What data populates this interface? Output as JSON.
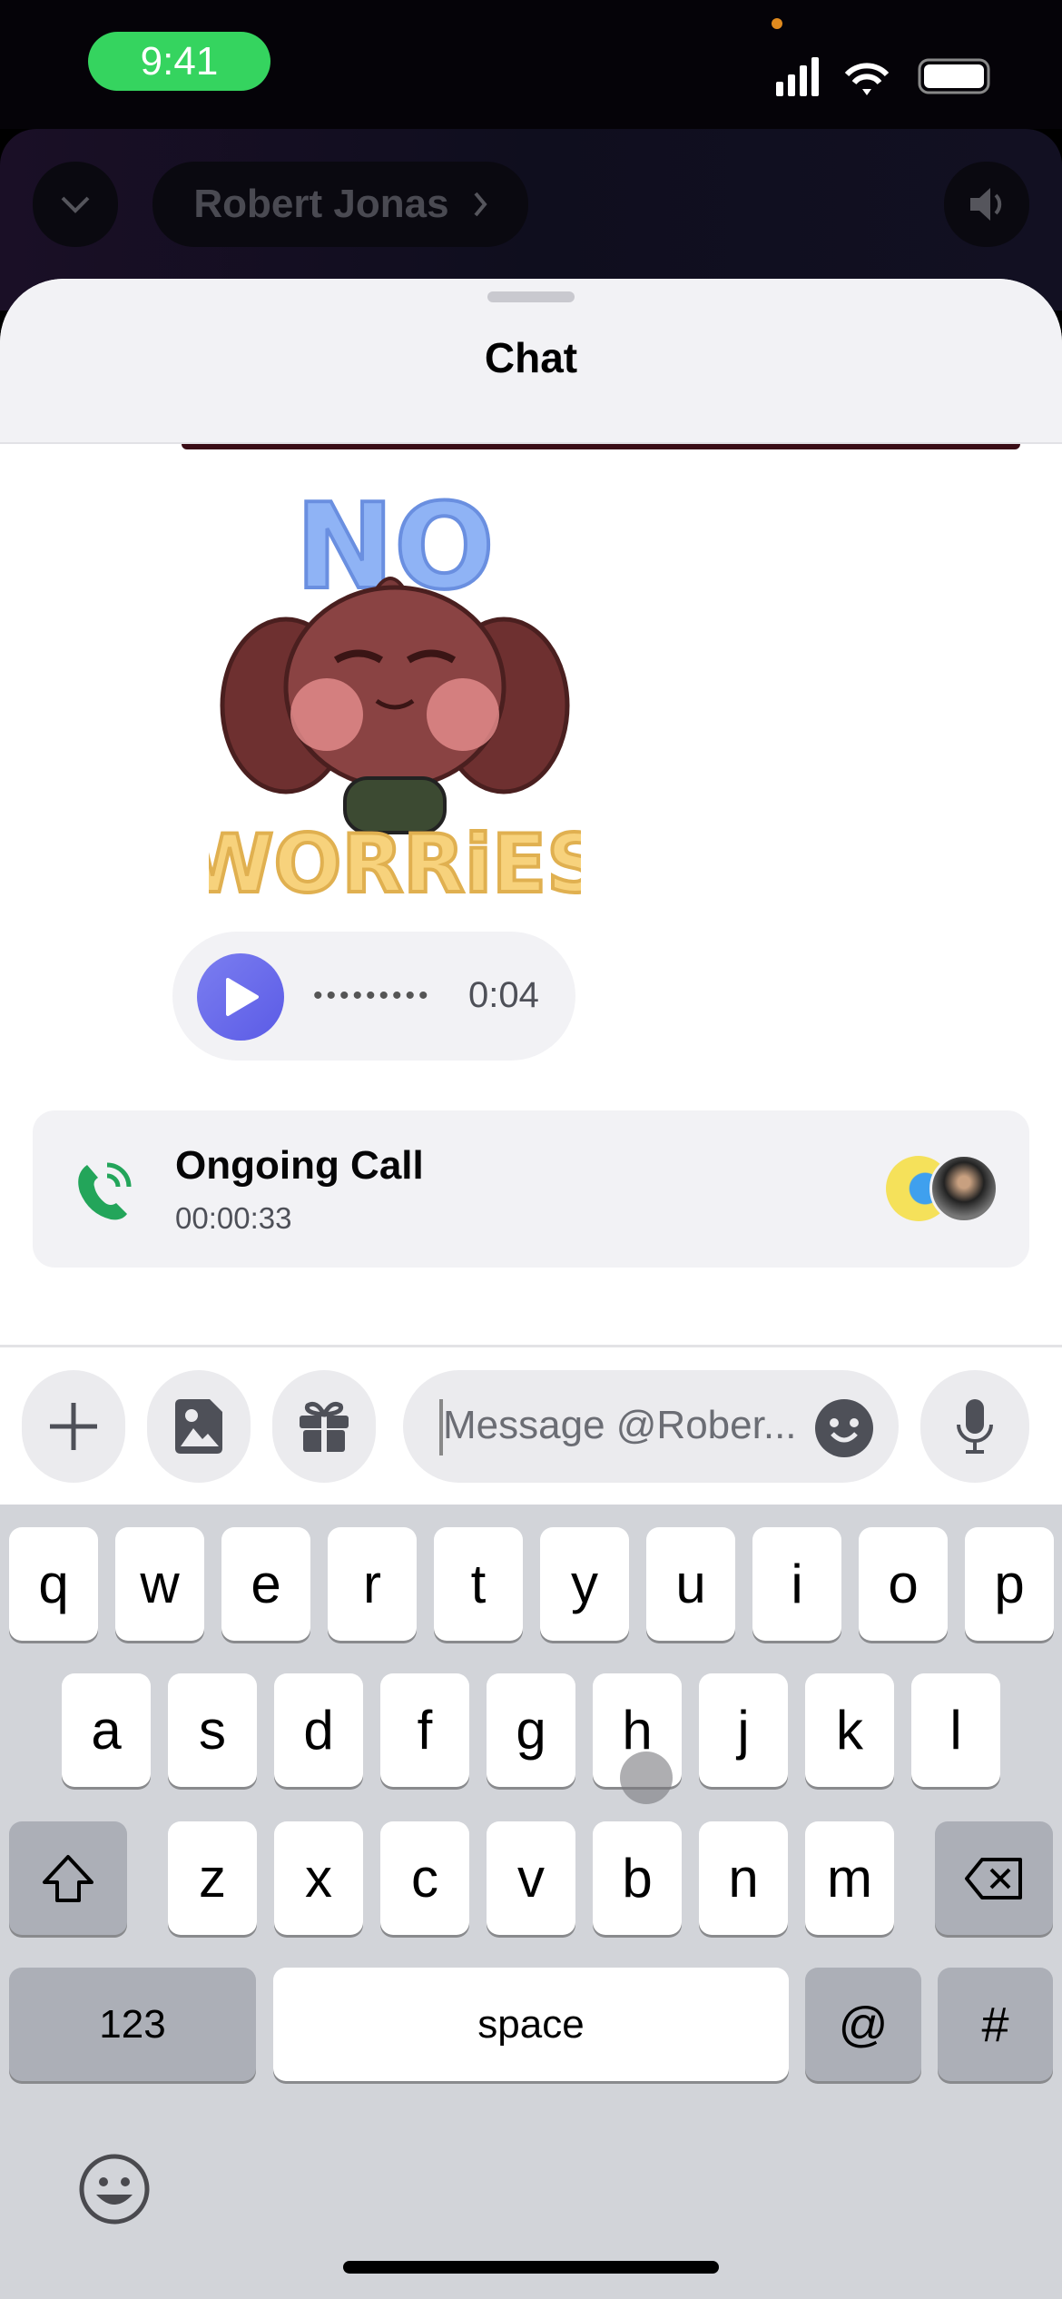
{
  "status_bar": {
    "time": "9:41",
    "icons": [
      "cellular-signal-icon",
      "wifi-icon",
      "battery-icon"
    ]
  },
  "call_header": {
    "contact": "Robert Jonas",
    "icons": [
      "chevron-down-icon",
      "chevron-right-icon",
      "speaker-icon"
    ]
  },
  "sheet": {
    "title": "Chat"
  },
  "sticker": {
    "text_top": "NO",
    "text_bottom": "WORRiES"
  },
  "voice_message": {
    "duration": "0:04",
    "waveform": "•••••••••"
  },
  "call_card": {
    "title": "Ongoing Call",
    "elapsed": "00:00:33",
    "accent": "#23a55a"
  },
  "composer": {
    "placeholder": "Message @Rober...",
    "icons": [
      "plus-icon",
      "image-icon",
      "gift-icon",
      "emoji-icon",
      "microphone-icon"
    ]
  },
  "keyboard": {
    "row1": [
      "q",
      "w",
      "e",
      "r",
      "t",
      "y",
      "u",
      "i",
      "o",
      "p"
    ],
    "row2": [
      "a",
      "s",
      "d",
      "f",
      "g",
      "h",
      "j",
      "k",
      "l"
    ],
    "row3": [
      "z",
      "x",
      "c",
      "v",
      "b",
      "n",
      "m"
    ],
    "numbers": "123",
    "space": "space",
    "at": "@",
    "hash": "#"
  },
  "colors": {
    "accent": "#5865f2",
    "online_green": "#35d45f"
  }
}
